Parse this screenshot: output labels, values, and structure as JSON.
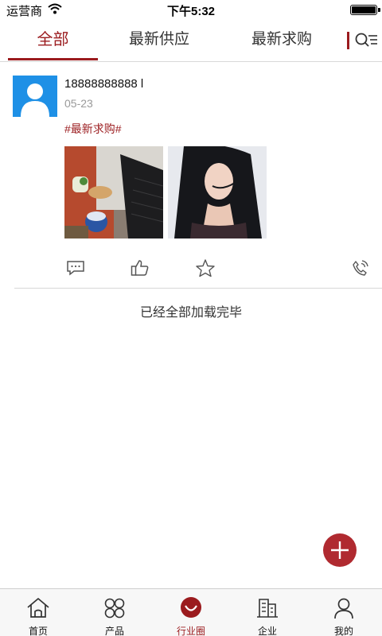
{
  "status_bar": {
    "carrier": "运营商",
    "time": "下午5:32",
    "battery_level": 1.0
  },
  "tabs": [
    {
      "label": "全部",
      "active": true
    },
    {
      "label": "最新供应",
      "active": false
    },
    {
      "label": "最新求购",
      "active": false
    }
  ],
  "post": {
    "poster_name": "18888888888 l",
    "date": "05-23",
    "tag": "#最新求购#",
    "photos": [
      "photo",
      "photo"
    ],
    "actions": [
      "comment-icon",
      "like-icon",
      "favorite-icon",
      "phone-icon"
    ]
  },
  "feed": {
    "load_complete": "已经全部加载完毕"
  },
  "bottom_nav": [
    {
      "label": "首页",
      "icon": "home-icon",
      "active": false
    },
    {
      "label": "产品",
      "icon": "products-icon",
      "active": false
    },
    {
      "label": "行业圈",
      "icon": "industry-circle-icon",
      "active": true
    },
    {
      "label": "企业",
      "icon": "enterprise-icon",
      "active": false
    },
    {
      "label": "我的",
      "icon": "profile-icon",
      "active": false
    }
  ],
  "colors": {
    "accent": "#9b1b1e",
    "avatar_bg": "#1e90e6",
    "fab": "#b02a30"
  }
}
